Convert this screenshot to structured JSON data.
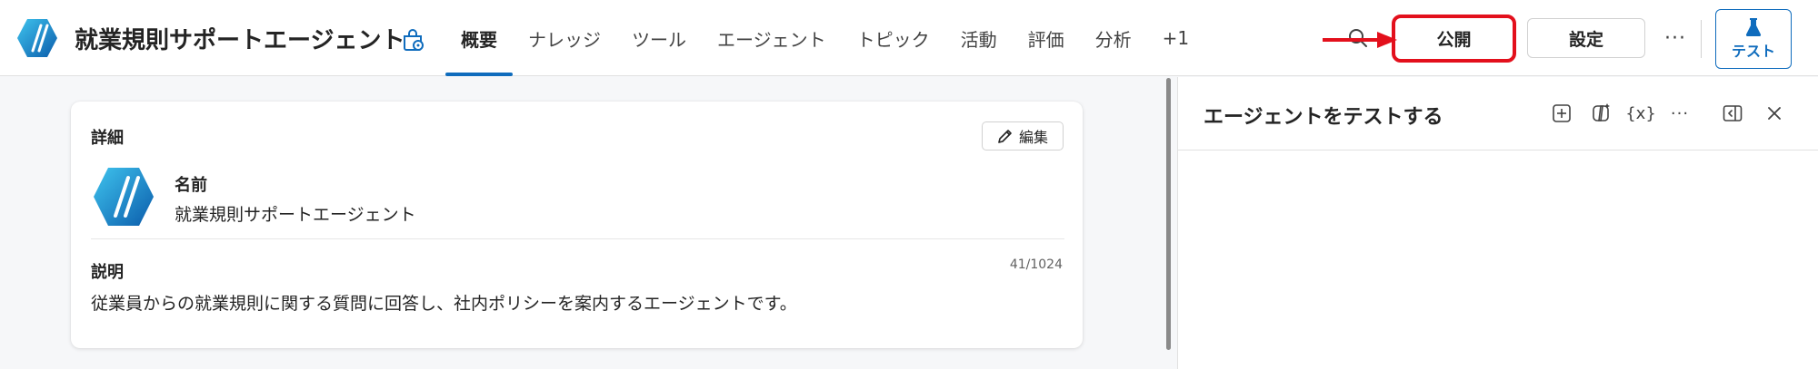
{
  "header": {
    "title": "就業規則サポートエージェント",
    "tabs": [
      {
        "label": "概要",
        "active": true
      },
      {
        "label": "ナレッジ",
        "active": false
      },
      {
        "label": "ツール",
        "active": false
      },
      {
        "label": "エージェント",
        "active": false
      },
      {
        "label": "トピック",
        "active": false
      },
      {
        "label": "活動",
        "active": false
      },
      {
        "label": "評価",
        "active": false
      },
      {
        "label": "分析",
        "active": false
      },
      {
        "label": "+1",
        "active": false
      }
    ],
    "publish_label": "公開",
    "settings_label": "設定",
    "more_label": "···",
    "test_label": "テスト"
  },
  "details": {
    "title": "詳細",
    "edit_label": "編集",
    "name_label": "名前",
    "name_value": "就業規則サポートエージェント",
    "description_label": "説明",
    "char_count": "41/1024",
    "description_value": "従業員からの就業規則に関する質問に回答し、社内ポリシーを案内するエージェントです。"
  },
  "test_panel": {
    "title": "エージェントをテストする",
    "variables_label": "{x}",
    "more_label": "···"
  },
  "colors": {
    "accent": "#0f6cbd",
    "highlight": "#e3101c",
    "logo_start": "#34b7e8",
    "logo_end": "#0b5cab"
  },
  "icons": [
    "agent-logo-icon",
    "agent-settings-icon",
    "search-icon",
    "red-arrow-icon",
    "flask-icon",
    "pencil-icon",
    "add-icon",
    "copilot-icon",
    "variables-icon",
    "more-icon",
    "panel-toggle-icon",
    "close-icon"
  ]
}
